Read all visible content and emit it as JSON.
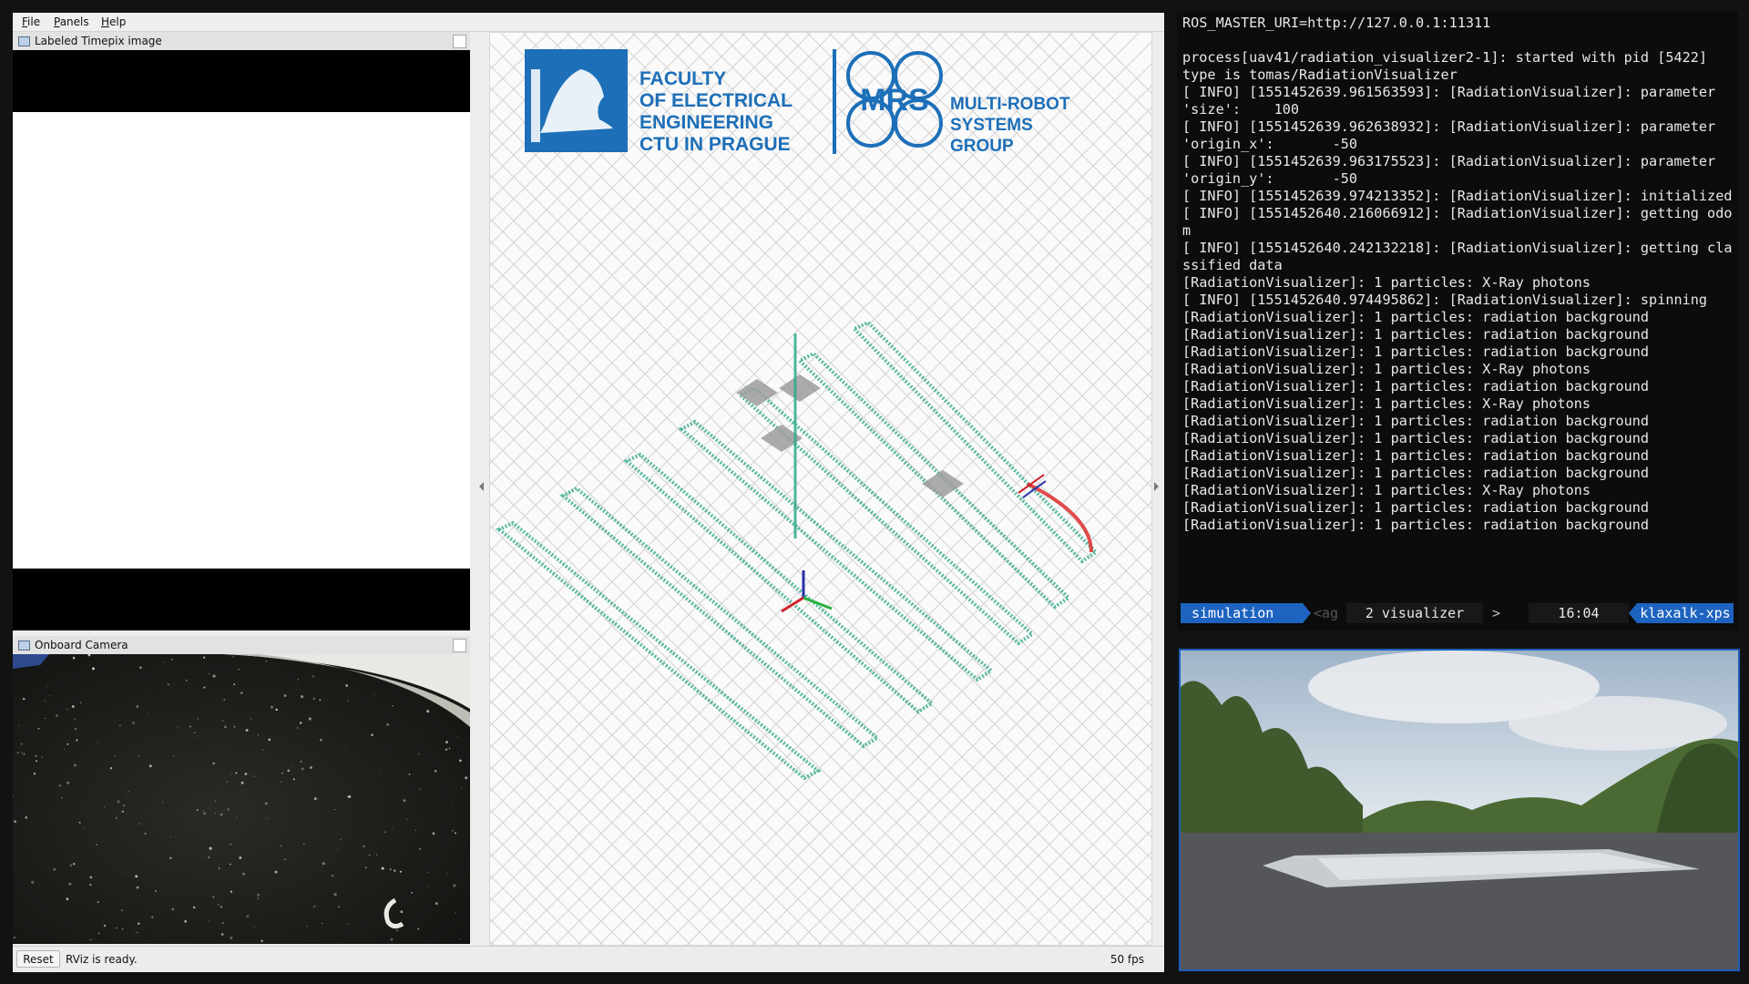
{
  "menubar": {
    "items": [
      {
        "label": "File"
      },
      {
        "label": "Panels"
      },
      {
        "label": "Help"
      }
    ]
  },
  "panels": {
    "timepix": {
      "title": "Labeled Timepix image"
    },
    "camera": {
      "title": "Onboard Camera"
    }
  },
  "view3d": {
    "logo": {
      "faculty_lines": [
        "FACULTY",
        "OF ELECTRICAL",
        "ENGINEERING",
        "CTU IN PRAGUE"
      ],
      "mrs_mark": "MRS",
      "mrs_lines": [
        "MULTI-ROBOT",
        "SYSTEMS",
        "GROUP"
      ],
      "brand_color": "#1d6fb8"
    },
    "path_color": "#2fa98a",
    "grid_color": "#d2d2d2"
  },
  "statusbar": {
    "reset_label": "Reset",
    "status_text": "RViz is ready.",
    "fps": "50 fps"
  },
  "terminal": {
    "lines": [
      "ROS_MASTER_URI=http://127.0.0.1:11311",
      "",
      "process[uav41/radiation_visualizer2-1]: started with pid [5422]",
      "type is tomas/RadiationVisualizer",
      "[ INFO] [1551452639.961563593]: [RadiationVisualizer]: parameter 'size':    100",
      "[ INFO] [1551452639.962638932]: [RadiationVisualizer]: parameter 'origin_x':       -50",
      "[ INFO] [1551452639.963175523]: [RadiationVisualizer]: parameter 'origin_y':       -50",
      "[ INFO] [1551452639.974213352]: [RadiationVisualizer]: initialized",
      "[ INFO] [1551452640.216066912]: [RadiationVisualizer]: getting odom",
      "[ INFO] [1551452640.242132218]: [RadiationVisualizer]: getting classified data",
      "[RadiationVisualizer]: 1 particles: X-Ray photons",
      "[ INFO] [1551452640.974495862]: [RadiationVisualizer]: spinning",
      "[RadiationVisualizer]: 1 particles: radiation background",
      "[RadiationVisualizer]: 1 particles: radiation background",
      "[RadiationVisualizer]: 1 particles: radiation background",
      "[RadiationVisualizer]: 1 particles: X-Ray photons",
      "[RadiationVisualizer]: 1 particles: radiation background",
      "[RadiationVisualizer]: 1 particles: X-Ray photons",
      "[RadiationVisualizer]: 1 particles: radiation background",
      "[RadiationVisualizer]: 1 particles: radiation background",
      "[RadiationVisualizer]: 1 particles: radiation background",
      "[RadiationVisualizer]: 1 particles: radiation background",
      "[RadiationVisualizer]: 1 particles: X-Ray photons",
      "[RadiationVisualizer]: 1 particles: radiation background",
      "[RadiationVisualizer]: 1 particles: radiation background"
    ],
    "tmux": {
      "session": "simulation",
      "prev_window": "<ag",
      "window": "2 visualizer",
      "next_window": ">",
      "time": "16:04",
      "host": "klaxalk-xps"
    },
    "accent_color": "#1e63c0"
  }
}
